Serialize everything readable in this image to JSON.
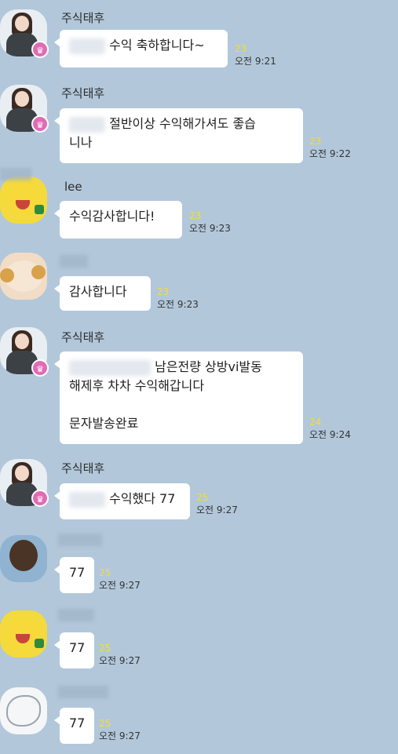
{
  "messages": [
    {
      "sender": "주식태후",
      "avatar": "woman-avatar",
      "text": "수익 축하합니다~",
      "unread": "23",
      "time": "오전 9:21"
    },
    {
      "sender": "주식태후",
      "avatar": "woman-avatar",
      "line1": "절반이상 수익해가셔도 좋습",
      "line2": "니나",
      "unread": "23",
      "time": "오전 9:22"
    },
    {
      "sender": "lee",
      "avatar": "yellow-character-avatar",
      "text": "수익감사합니다!",
      "unread": "23",
      "time": "오전 9:23"
    },
    {
      "sender": "",
      "avatar": "cheerleader-character-avatar",
      "text": "감사합니다",
      "unread": "23",
      "time": "오전 9:23"
    },
    {
      "sender": "주식태후",
      "avatar": "woman-avatar",
      "line1": "남은전량 상방vi발동",
      "line2": "해제후 차차 수익해갑니다",
      "line3": "문자발송완료",
      "unread": "24",
      "time": "오전 9:24"
    },
    {
      "sender": "주식태후",
      "avatar": "woman-avatar",
      "text": "수익했다 77",
      "unread": "25",
      "time": "오전 9:27"
    },
    {
      "sender": "",
      "avatar": "bear-character-avatar",
      "text": "77",
      "unread": "25",
      "time": "오전 9:27"
    },
    {
      "sender": "",
      "avatar": "yellow-character-avatar",
      "text": "77",
      "unread": "25",
      "time": "오전 9:27"
    },
    {
      "sender": "",
      "avatar": "sketch-avatar",
      "text": "77",
      "unread": "25",
      "time": "오전 9:27"
    }
  ]
}
